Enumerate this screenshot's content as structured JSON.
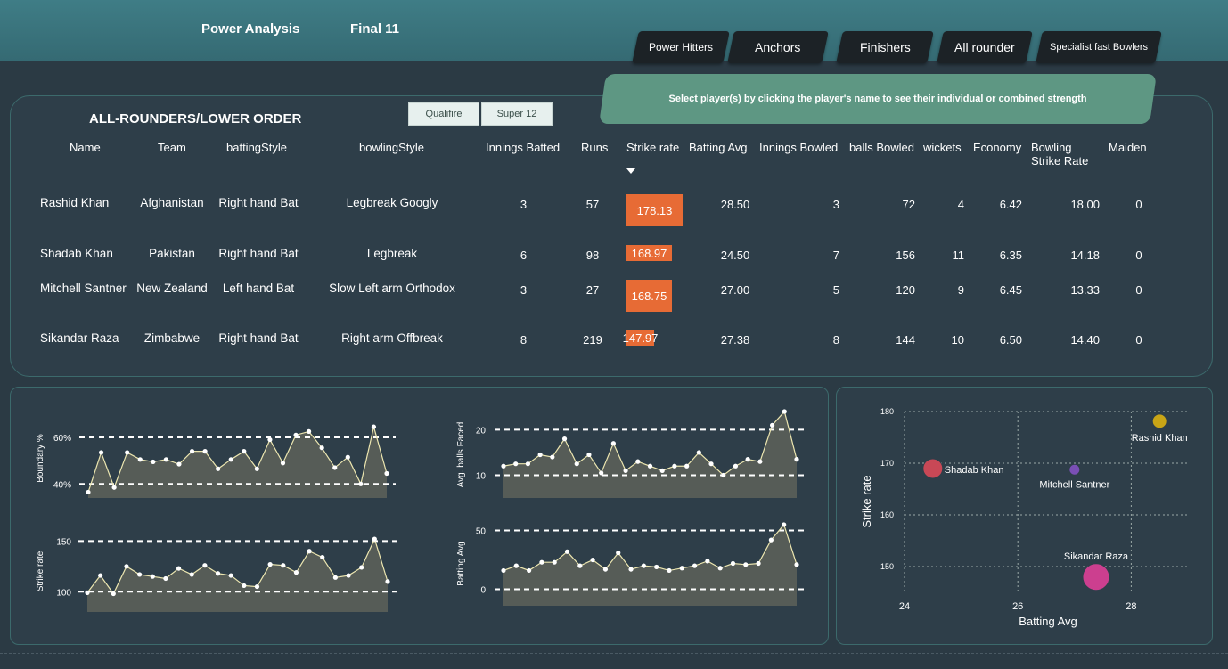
{
  "header": {
    "nav": [
      "Power Analysis",
      "Final 11"
    ],
    "categories": [
      "Power Hitters",
      "Anchors",
      "Finishers",
      "All rounder",
      "Specialist fast Bowlers"
    ],
    "banner_text": "Select player(s) by clicking the player's name to see their individual or combined strength"
  },
  "table_title": "ALL-ROUNDERS/LOWER ORDER",
  "slicers": [
    "Qualifire",
    "Super 12"
  ],
  "columns": [
    "Name",
    "Team",
    "battingStyle",
    "bowlingStyle",
    "Innings Batted",
    "Runs",
    "Strike rate",
    "Batting Avg",
    "Innings Bowled",
    "balls Bowled",
    "wickets",
    "Economy",
    "Bowling Strike Rate",
    "Maiden"
  ],
  "rows": [
    {
      "name": "Rashid Khan",
      "team": "Afghanistan",
      "batting": "Right hand Bat",
      "bowling": "Legbreak Googly",
      "inn_bat": "3",
      "runs": "57",
      "sr": "178.13",
      "sr_val": 178.13,
      "bat_avg": "28.50",
      "inn_bowl": "3",
      "balls": "72",
      "wkts": "4",
      "econ": "6.42",
      "bsr": "18.00",
      "maiden": "0"
    },
    {
      "name": "Shadab Khan",
      "team": "Pakistan",
      "batting": "Right hand Bat",
      "bowling": "Legbreak",
      "inn_bat": "6",
      "runs": "98",
      "sr": "168.97",
      "sr_val": 168.97,
      "bat_avg": "24.50",
      "inn_bowl": "7",
      "balls": "156",
      "wkts": "11",
      "econ": "6.35",
      "bsr": "14.18",
      "maiden": "0"
    },
    {
      "name": "Mitchell Santner",
      "team": "New Zealand",
      "batting": "Left hand Bat",
      "bowling": "Slow Left arm Orthodox",
      "inn_bat": "3",
      "runs": "27",
      "sr": "168.75",
      "sr_val": 168.75,
      "bat_avg": "27.00",
      "inn_bowl": "5",
      "balls": "120",
      "wkts": "9",
      "econ": "6.45",
      "bsr": "13.33",
      "maiden": "0"
    },
    {
      "name": "Sikandar Raza",
      "team": "Zimbabwe",
      "batting": "Right hand Bat",
      "bowling": "Right arm Offbreak",
      "inn_bat": "8",
      "runs": "219",
      "sr": "147.97",
      "sr_val": 147.97,
      "bat_avg": "27.38",
      "inn_bowl": "8",
      "balls": "144",
      "wkts": "10",
      "econ": "6.50",
      "bsr": "14.40",
      "maiden": "0"
    }
  ],
  "chart_data": [
    {
      "type": "area",
      "ylabel": "Boundary %",
      "yticks": [
        "40%",
        "60%"
      ],
      "tick_values": [
        40,
        60
      ],
      "ylim": [
        34,
        68
      ],
      "values": [
        36.5,
        53.5,
        38.5,
        53.5,
        50.5,
        49.5,
        50.5,
        48.5,
        54,
        54,
        46.5,
        50.5,
        54,
        46.5,
        59,
        49,
        61,
        62.5,
        55.5,
        47,
        51.5,
        40,
        64.5,
        44.5
      ]
    },
    {
      "type": "area",
      "ylabel": "Avg. balls Faced",
      "yticks": [
        "10",
        "20"
      ],
      "tick_values": [
        10,
        20
      ],
      "ylim": [
        5,
        24
      ],
      "values": [
        12,
        12.5,
        12.5,
        14.5,
        14,
        18,
        12.5,
        14.5,
        10.5,
        17,
        11,
        13,
        12,
        11,
        12,
        12,
        15,
        12.5,
        10,
        12,
        13.5,
        13,
        21,
        24,
        13.5
      ]
    },
    {
      "type": "area",
      "ylabel": "Strike rate",
      "yticks": [
        "100",
        "150"
      ],
      "tick_values": [
        100,
        150
      ],
      "ylim": [
        80,
        160
      ],
      "values": [
        99,
        116,
        98,
        125,
        117,
        115,
        113,
        123,
        117,
        126,
        118,
        116,
        106,
        105,
        127,
        126,
        119,
        140,
        134,
        114,
        116,
        124,
        152,
        110
      ]
    },
    {
      "type": "area",
      "ylabel": "Batting Avg",
      "yticks": [
        "0",
        "50"
      ],
      "tick_values": [
        0,
        50
      ],
      "ylim": [
        -14,
        58
      ],
      "values": [
        16,
        20,
        16,
        23,
        23,
        32,
        20,
        25,
        17,
        31,
        17,
        20,
        19,
        16,
        18,
        20,
        24,
        18,
        22,
        21,
        22,
        42,
        55,
        21
      ]
    },
    {
      "type": "scatter",
      "xlabel": "Batting Avg",
      "ylabel": "Strike rate",
      "xticks": [
        24,
        26,
        28
      ],
      "yticks": [
        150,
        160,
        170,
        180
      ],
      "xlim": [
        24,
        29
      ],
      "ylim": [
        145,
        180
      ],
      "points": [
        {
          "name": "Rashid Khan",
          "x": 28.5,
          "y": 178.13,
          "color": "#c9a516",
          "size": 8
        },
        {
          "name": "Shadab Khan",
          "x": 24.5,
          "y": 168.97,
          "color": "#c84856",
          "size": 11
        },
        {
          "name": "Mitchell Santner",
          "x": 27.0,
          "y": 168.75,
          "color": "#7a4fb5",
          "size": 6
        },
        {
          "name": "Sikandar Raza",
          "x": 27.38,
          "y": 147.97,
          "color": "#cc3f8f",
          "size": 15
        }
      ]
    }
  ]
}
